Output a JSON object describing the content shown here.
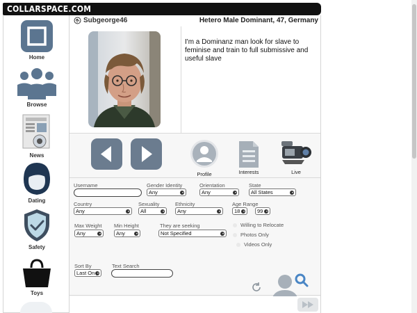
{
  "site": {
    "logo": "COLLARSPACE.COM"
  },
  "sidebar": {
    "items": [
      {
        "label": "Home",
        "icon": "home-icon"
      },
      {
        "label": "Browse",
        "icon": "people-icon"
      },
      {
        "label": "News",
        "icon": "newspaper-icon"
      },
      {
        "label": "Dating",
        "icon": "woman-icon"
      },
      {
        "label": "Safety",
        "icon": "shield-icon"
      },
      {
        "label": "Toys",
        "icon": "shopping-bag-icon"
      }
    ]
  },
  "profile": {
    "username": "Subgeorge46",
    "headline": "Hetero Male Dominant, 47, Germany",
    "about": "I'm a Dominanz man look for slave to feminise and train to full submissive and useful slave"
  },
  "controls": {
    "profile_label": "Profile",
    "interests_label": "Interests",
    "live_label": "Live"
  },
  "search": {
    "username_label": "Username",
    "username_value": "",
    "gender_label": "Gender Identity",
    "gender_value": "Any",
    "orientation_label": "Orientation",
    "orientation_value": "Any",
    "state_label": "State",
    "state_value": "All States",
    "country_label": "Country",
    "country_value": "Any",
    "sexuality_label": "Sexuality",
    "sexuality_value": "All",
    "ethnicity_label": "Ethnicity",
    "ethnicity_value": "Any",
    "age_label": "Age Range",
    "age_min": "18",
    "age_max": "99",
    "weight_label": "Max Weight",
    "weight_value": "Any",
    "height_label": "Min Height",
    "height_value": "Any",
    "seeking_label": "They are seeking",
    "seeking_value": "Not Specified",
    "relocate_label": "Willing to Relocate",
    "photos_label": "Photos Only",
    "videos_label": "Videos Only",
    "sort_label": "Sort By",
    "sort_value": "Last On",
    "text_search_label": "Text Search",
    "text_search_value": ""
  },
  "colors": {
    "accent_blue": "#4a86c5",
    "button_slate": "#6b7c8f",
    "header_black": "#111111"
  }
}
